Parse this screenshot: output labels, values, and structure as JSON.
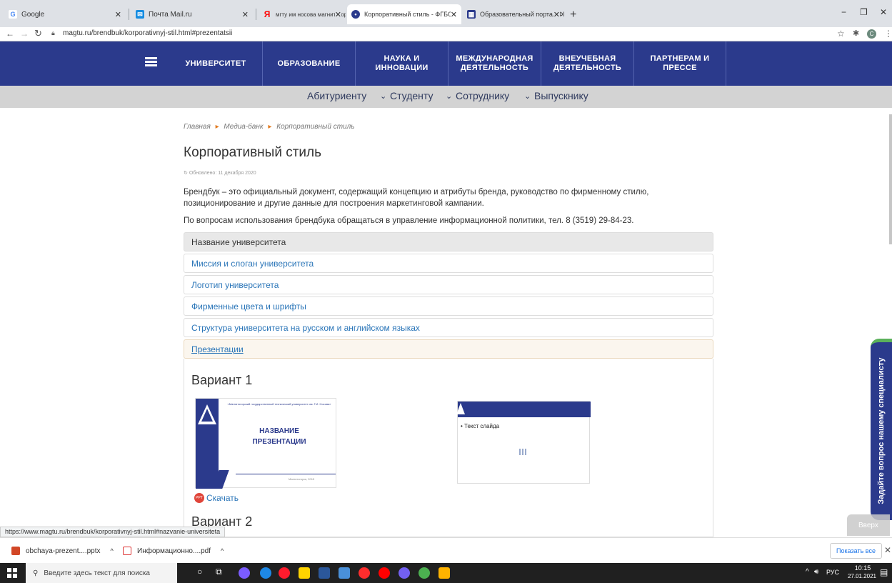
{
  "browser": {
    "tabs": [
      {
        "label": "Google"
      },
      {
        "label": "Почта Mail.ru"
      },
      {
        "label": "мгту им носова магнитогорск с"
      },
      {
        "label": "Корпоративный стиль - ФГБОУ"
      },
      {
        "label": "Образовательный портал ФГБС"
      }
    ],
    "new_tab": "+",
    "url": "magtu.ru/brendbuk/korporativnyj-stil.html#prezentatsii",
    "window_controls": {
      "minimize": "−",
      "restore": "❐",
      "close": "✕"
    }
  },
  "header": {
    "menu_icon": "hamburger-icon",
    "nav": [
      "УНИВЕРСИТЕТ",
      "ОБРАЗОВАНИЕ",
      "НАУКА И ИННОВАЦИИ",
      "МЕЖДУНАРОДНАЯ ДЕЯТЕЛЬНОСТЬ",
      "ВНЕУЧЕБНАЯ ДЕЯТЕЛЬНОСТЬ",
      "ПАРТНЕРАМ И ПРЕССЕ"
    ],
    "subnav": [
      "Абитуриенту",
      "Студенту",
      "Сотруднику",
      "Выпускнику"
    ]
  },
  "breadcrumb": [
    "Главная",
    "Медиа-банк",
    "Корпоративный стиль"
  ],
  "page": {
    "title": "Корпоративный стиль",
    "updated": "Обновлено: 11 декабря 2020",
    "intro": "Брендбук – это официальный документ, содержащий концепцию и атрибуты бренда, руководство по фирменному стилю, позиционирование и другие данные для построения маркетинговой кампании.",
    "contact": "По вопросам использования брендбука обращаться в управление информационной политики, тел. 8 (3519) 29-84-23."
  },
  "accordion": [
    "Название университета",
    "Миссия и слоган университета",
    "Логотип университета",
    "Фирменные цвета и шрифты",
    "Структура университета на русском и английском языках",
    "Презентации"
  ],
  "presentations": {
    "variant1": "Вариант 1",
    "variant2": "Вариант 2",
    "slide1_org": "«Магнитогорский государственный технический университет им. Г.И. Носова»",
    "slide1_title": "НАЗВАНИЕ ПРЕЗЕНТАЦИИ",
    "slide1_footer": "Магнитогорск, 2015",
    "slide2_text": "• Текст слайда",
    "download": "Скачать"
  },
  "side": {
    "ask_specialist": "Задайте вопрос нашему специалисту",
    "up": "Вверх"
  },
  "status_url": "https://www.magtu.ru/brendbuk/korporativnyj-stil.html#nazvanie-universiteta",
  "downloads": {
    "items": [
      "obchaya-prezent....pptx",
      "Информационно....pdf"
    ],
    "show_all": "Показать все"
  },
  "taskbar": {
    "search_placeholder": "Введите здесь текст для поиска",
    "lang": "РУС",
    "time": "10:15",
    "date": "27.01.2021"
  },
  "colors": {
    "nav": "#2b3a8c",
    "subnav": "#d3d3d3",
    "link": "#2a75b8",
    "side_button": "#2b3a8c"
  }
}
